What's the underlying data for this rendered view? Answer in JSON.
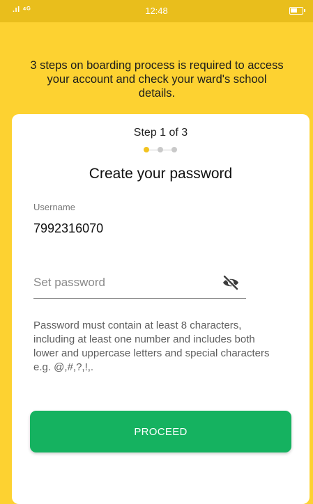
{
  "status_bar": {
    "signal": "4G LTE",
    "time": "12:48"
  },
  "intro": {
    "text": "3 steps on boarding process is required to access your account and check your ward's school details."
  },
  "card": {
    "step": "Step 1 of 3",
    "progress": {
      "current": 1,
      "total": 3
    },
    "title": "Create your password",
    "username": {
      "label": "Username",
      "value": "7992316070"
    },
    "password": {
      "placeholder": "Set password",
      "value": "",
      "icon": "eye-off-icon"
    },
    "hint": "Password must contain at least 8 characters, including at least one number and includes both lower and uppercase letters and special characters e.g. @,#,?,!,.",
    "proceed_label": "PROCEED"
  },
  "colors": {
    "background": "#fdd231",
    "status_bar": "#e9be1c",
    "accent_dot": "#f2c31f",
    "button": "#15b260"
  }
}
